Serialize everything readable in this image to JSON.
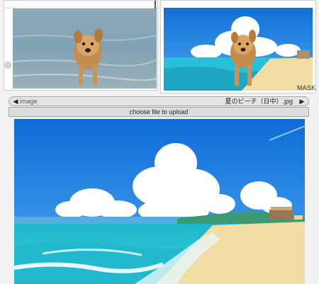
{
  "selector": {
    "label": "image",
    "filename": "夏のビーチ（日中）.jpg",
    "prev_icon": "triangle-left-icon",
    "next_icon": "triangle-right-icon"
  },
  "upload": {
    "label": "choose file to upload"
  },
  "composite": {
    "mask_label": "MASK"
  },
  "colors": {
    "sky": "#1e82e6",
    "sea": "#28c7d8",
    "sand": "#f0dca6",
    "cloud": "#ffffff"
  }
}
